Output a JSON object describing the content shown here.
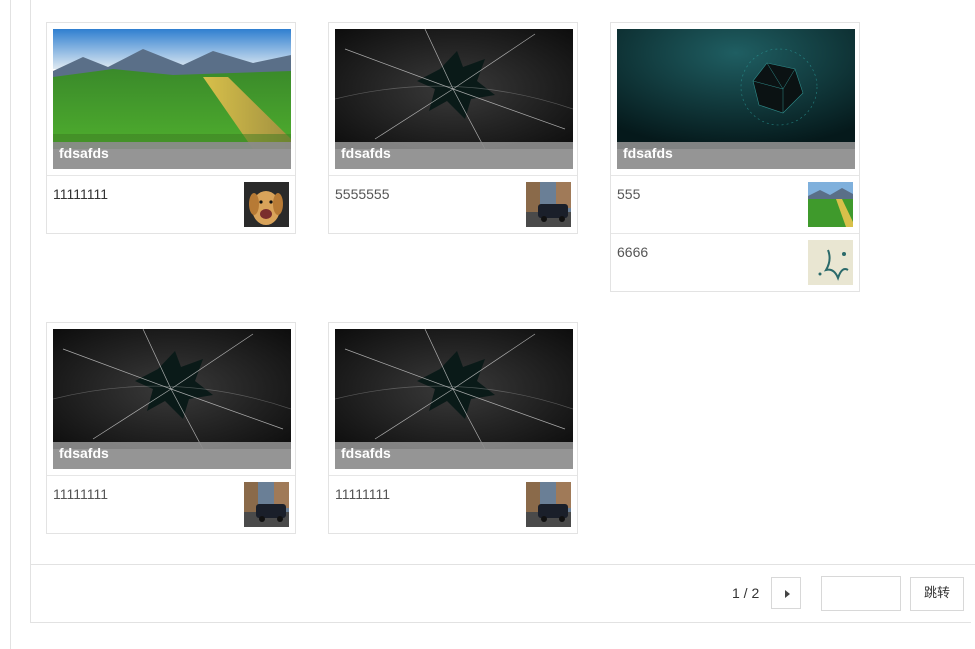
{
  "cards": [
    {
      "cover": {
        "caption": "fdsafds",
        "image": "green-field-landscape"
      },
      "items": [
        {
          "title": "11111111",
          "thumb": "dog-photo"
        }
      ]
    },
    {
      "cover": {
        "caption": "fdsafds",
        "image": "shattered-glass"
      },
      "items": [
        {
          "title": "5555555",
          "thumb": "street-car-photo"
        }
      ]
    },
    {
      "cover": {
        "caption": "fdsafds",
        "image": "teal-polyhedron"
      },
      "items": [
        {
          "title": "555",
          "thumb": "green-field-landscape"
        },
        {
          "title": "6666",
          "thumb": "splash-art"
        }
      ]
    },
    {
      "cover": {
        "caption": "fdsafds",
        "image": "shattered-glass"
      },
      "items": [
        {
          "title": "11111111",
          "thumb": "street-car-photo"
        }
      ]
    },
    {
      "cover": {
        "caption": "fdsafds",
        "image": "shattered-glass"
      },
      "items": [
        {
          "title": "11111111",
          "thumb": "street-car-photo"
        }
      ]
    }
  ],
  "pagination": {
    "indicator": "1 / 2",
    "jump_value": "",
    "jump_label": "跳转",
    "next_icon": "caret-right-icon"
  }
}
